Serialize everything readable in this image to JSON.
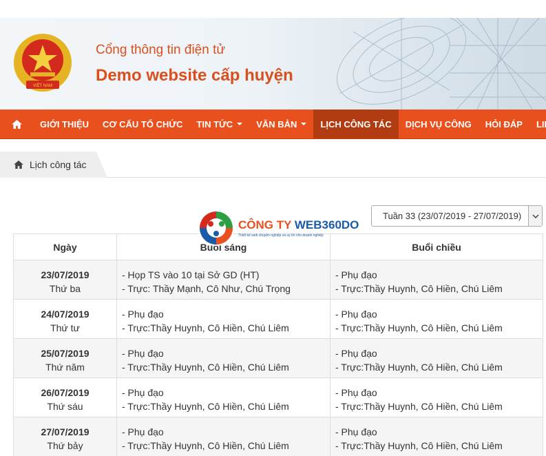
{
  "header": {
    "subtitle": "Cổng thông tin điện tử",
    "title": "Demo website cấp huyện",
    "emblem_text": "VIỆT NAM"
  },
  "nav": {
    "items": [
      {
        "label": "GIỚI THIỆU",
        "dropdown": false
      },
      {
        "label": "CƠ CẤU TỔ CHỨC",
        "dropdown": false
      },
      {
        "label": "TIN TỨC",
        "dropdown": true
      },
      {
        "label": "VĂN BẢN",
        "dropdown": true
      },
      {
        "label": "LỊCH CÔNG TÁC",
        "dropdown": false,
        "active": true
      },
      {
        "label": "DỊCH VỤ CÔNG",
        "dropdown": false
      },
      {
        "label": "HỎI ĐÁP",
        "dropdown": false
      },
      {
        "label": "LIÊN HỆ",
        "dropdown": false
      }
    ],
    "active_color": "#b23c12",
    "bar_color": "#e8501d"
  },
  "breadcrumb": {
    "label": "Lịch công tác"
  },
  "week_select": {
    "value": "Tuần 33 (23/07/2019 - 27/07/2019)"
  },
  "watermark": {
    "part1": "CÔNG TY",
    "part2": "WEB360DO",
    "tagline": "Thiết kế web chuyên nghiệp và uy tín cho doanh nghiệp"
  },
  "table": {
    "headers": [
      "Ngày",
      "Buổi sáng",
      "Buổi chiều"
    ],
    "rows": [
      {
        "date": "23/07/2019",
        "day": "Thứ ba",
        "am": [
          "- Họp TS vào 10 tại Sở GD (HT)",
          "- Trực: Thầy Mạnh, Cô Như, Chú Trọng"
        ],
        "pm": [
          "- Phụ đạo",
          "- Trực:Thầy Huynh, Cô Hiền, Chú Liêm"
        ]
      },
      {
        "date": "24/07/2019",
        "day": "Thứ tư",
        "am": [
          "- Phụ đạo",
          "- Trực:Thầy Huynh, Cô Hiền, Chú Liêm"
        ],
        "pm": [
          "- Phụ đạo",
          "- Trực:Thầy Huynh, Cô Hiền, Chú Liêm"
        ]
      },
      {
        "date": "25/07/2019",
        "day": "Thứ năm",
        "am": [
          "- Phụ đạo",
          "- Trực:Thầy Huynh, Cô Hiền, Chú Liêm"
        ],
        "pm": [
          "- Phụ đạo",
          "- Trực:Thầy Huynh, Cô Hiền, Chú Liêm"
        ]
      },
      {
        "date": "26/07/2019",
        "day": "Thứ sáu",
        "am": [
          "- Phụ đạo",
          "- Trực:Thầy Huynh, Cô Hiền, Chú Liêm"
        ],
        "pm": [
          "- Phụ đạo",
          "- Trực:Thầy Huynh, Cô Hiền, Chú Liêm"
        ]
      },
      {
        "date": "27/07/2019",
        "day": "Thứ bảy",
        "am": [
          "- Phụ đạo",
          "- Trực:Thầy Huynh, Cô Hiền, Chú Liêm"
        ],
        "pm": [
          "- Phụ đạo",
          "- Trực:Thầy Huynh, Cô Hiền, Chú Liêm"
        ]
      }
    ]
  }
}
